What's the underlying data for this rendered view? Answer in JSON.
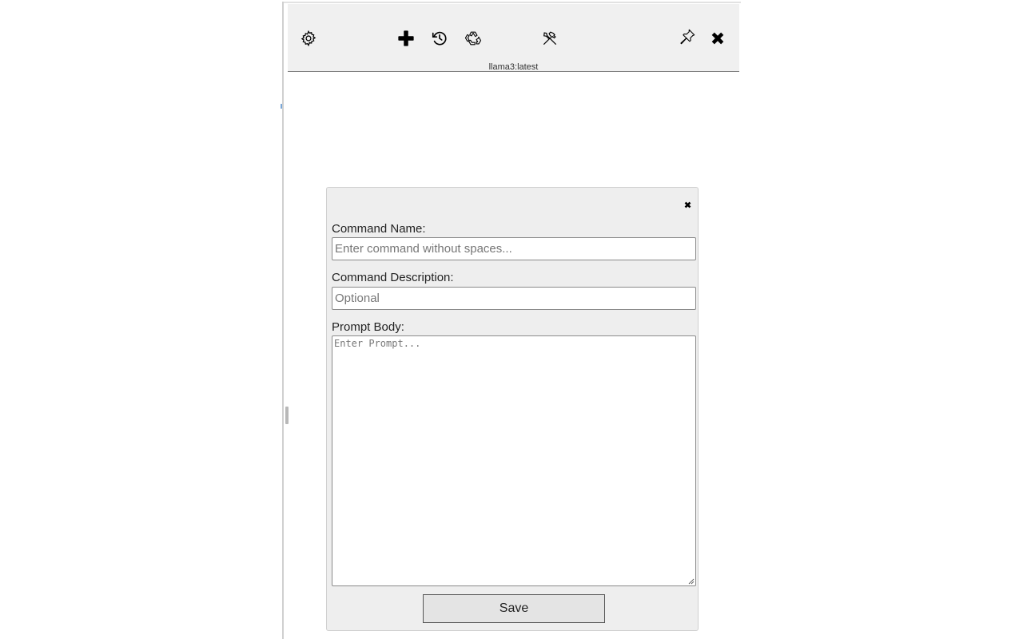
{
  "toolbar": {
    "buttons": {
      "settings": "gear-icon",
      "new_chat": "plus-icon",
      "history": "history-icon",
      "recycle": "recycle-icon",
      "tools": "tools-icon",
      "pin": "pin-icon",
      "close": "close-icon"
    },
    "model_label": "llama3:latest"
  },
  "dialog": {
    "close_icon": "close-icon",
    "command_name": {
      "label": "Command Name:",
      "placeholder": "Enter command without spaces...",
      "value": ""
    },
    "command_description": {
      "label": "Command Description:",
      "placeholder": "Optional",
      "value": ""
    },
    "prompt_body": {
      "label": "Prompt Body:",
      "placeholder": "Enter Prompt...",
      "value": ""
    },
    "save_label": "Save"
  },
  "colors": {
    "toolbar_bg": "#f0f0f0",
    "dialog_bg": "#eeeeee",
    "button_bg": "#e4e4e4"
  }
}
